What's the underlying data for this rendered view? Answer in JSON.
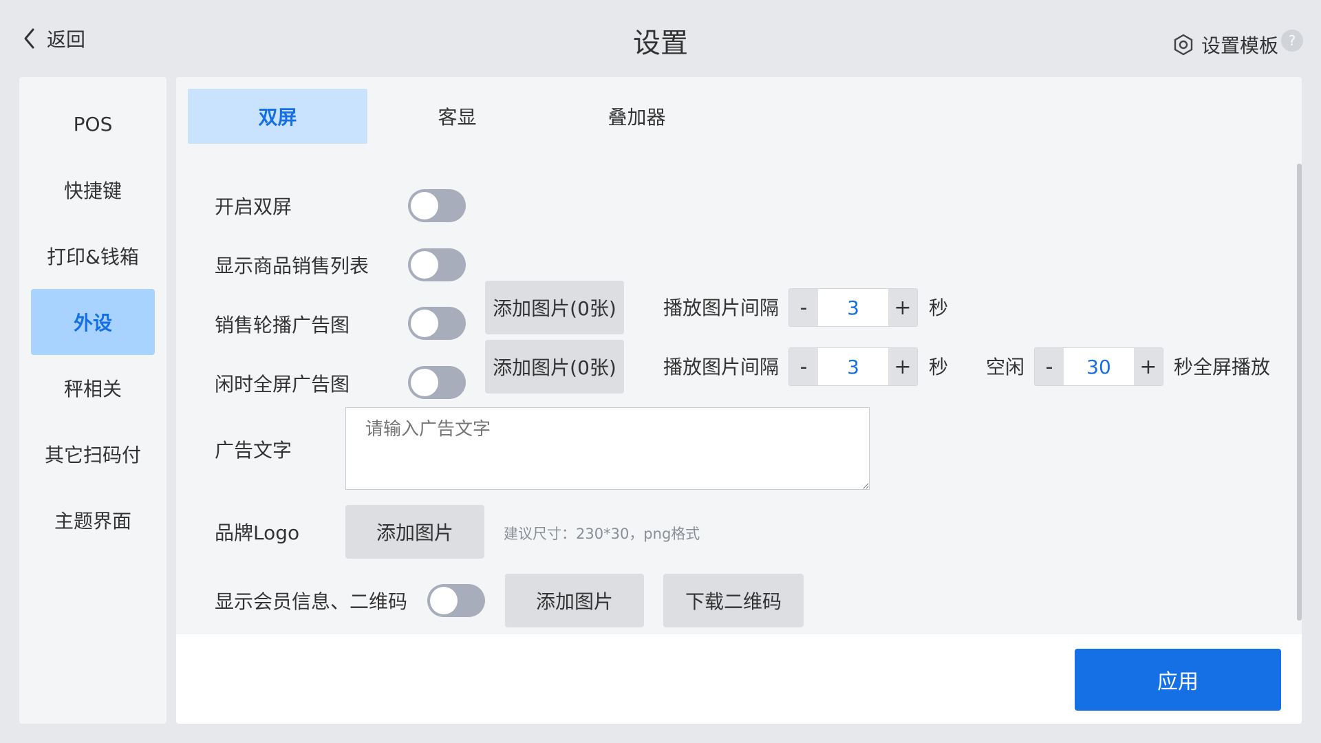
{
  "header": {
    "back_label": "返回",
    "title": "设置",
    "template_label": "设置模板",
    "help_label": "?"
  },
  "sidebar": {
    "items": [
      {
        "label": "POS"
      },
      {
        "label": "快捷键"
      },
      {
        "label": "打印&钱箱"
      },
      {
        "label": "外设"
      },
      {
        "label": "秤相关"
      },
      {
        "label": "其它扫码付"
      },
      {
        "label": "主题界面"
      }
    ],
    "active_index": 3
  },
  "tabs": [
    {
      "label": "双屏"
    },
    {
      "label": "客显"
    },
    {
      "label": "叠加器"
    }
  ],
  "settings": {
    "enable_dual": {
      "label": "开启双屏",
      "on": false
    },
    "show_sales_list": {
      "label": "显示商品销售列表",
      "on": false
    },
    "sales_carousel": {
      "label": "销售轮播广告图",
      "on": false,
      "add_label": "添加图片(0张)",
      "interval_label": "播放图片间隔",
      "interval_value": "3",
      "unit": "秒"
    },
    "idle_fullscreen": {
      "label": "闲时全屏广告图",
      "on": false,
      "add_label": "添加图片(0张)",
      "interval_label": "播放图片间隔",
      "interval_value": "3",
      "unit": "秒",
      "idle_label": "空闲",
      "idle_value": "30",
      "idle_unit": "秒全屏播放"
    },
    "ad_text": {
      "label": "广告文字",
      "placeholder": "请输入广告文字",
      "value": ""
    },
    "brand_logo": {
      "label": "品牌Logo",
      "add_label": "添加图片",
      "hint": "建议尺寸：230*30，png格式"
    },
    "member_qr": {
      "label": "显示会员信息、二维码",
      "on": false,
      "add_label": "添加图片",
      "download_label": "下载二维码"
    }
  },
  "stepper_minus": "-",
  "stepper_plus": "+",
  "footer": {
    "apply_label": "应用"
  },
  "colors": {
    "accent": "#1570e6",
    "active_bg": "#a8d3ff",
    "toggle_off": "#a7adbb"
  }
}
